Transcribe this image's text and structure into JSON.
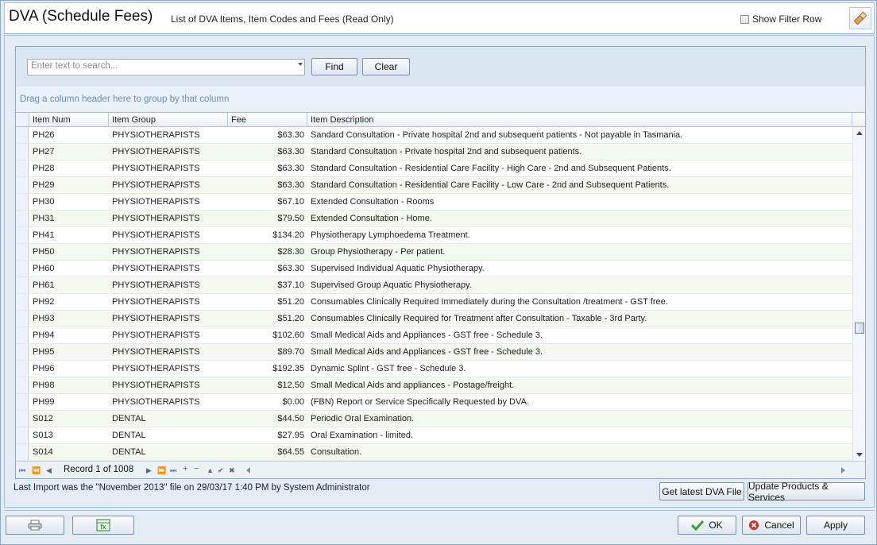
{
  "window": {
    "title": "DVA (Schedule Fees)",
    "subtitle": "List of DVA Items, Item Codes and Fees (Read Only)",
    "show_filter_row_label": "Show Filter Row",
    "show_filter_row_checked": false,
    "icon": "eraser-icon"
  },
  "search": {
    "placeholder": "Enter text to search...",
    "find_label": "Find",
    "clear_label": "Clear"
  },
  "group_panel": {
    "text": "Drag a column header here to group by that column"
  },
  "columns": [
    "Item Num",
    "Item Group",
    "Fee",
    "Item Description"
  ],
  "rows": [
    {
      "item": "PH26",
      "group": "PHYSIOTHERAPISTS",
      "fee": "$63.30",
      "desc": "Sandard Consultation - Private hospital 2nd and subsequent patients - Not payable in Tasmania."
    },
    {
      "item": "PH27",
      "group": "PHYSIOTHERAPISTS",
      "fee": "$63.30",
      "desc": "Standard Consultation - Private hospital 2nd and subsequent patients."
    },
    {
      "item": "PH28",
      "group": "PHYSIOTHERAPISTS",
      "fee": "$63.30",
      "desc": "Standard Consultation - Residential Care Facility - High Care - 2nd and Subsequent Patients."
    },
    {
      "item": "PH29",
      "group": "PHYSIOTHERAPISTS",
      "fee": "$63.30",
      "desc": "Standard Consultation - Residential Care Facility - Low Care - 2nd and Subsequent Patients."
    },
    {
      "item": "PH30",
      "group": "PHYSIOTHERAPISTS",
      "fee": "$67.10",
      "desc": "Extended Consultation - Rooms"
    },
    {
      "item": "PH31",
      "group": "PHYSIOTHERAPISTS",
      "fee": "$79.50",
      "desc": "Extended Consultation - Home."
    },
    {
      "item": "PH41",
      "group": "PHYSIOTHERAPISTS",
      "fee": "$134.20",
      "desc": "Physiotherapy Lymphoedema Treatment."
    },
    {
      "item": "PH50",
      "group": "PHYSIOTHERAPISTS",
      "fee": "$28.30",
      "desc": "Group Physiotherapy - Per patient."
    },
    {
      "item": "PH60",
      "group": "PHYSIOTHERAPISTS",
      "fee": "$63.30",
      "desc": "Supervised Individual Aquatic Physiotherapy."
    },
    {
      "item": "PH61",
      "group": "PHYSIOTHERAPISTS",
      "fee": "$37.10",
      "desc": "Supervised Group Aquatic Physiotherapy."
    },
    {
      "item": "PH92",
      "group": "PHYSIOTHERAPISTS",
      "fee": "$51.20",
      "desc": "Consumables Clinically Required Immediately during the Consultation /treatment - GST free."
    },
    {
      "item": "PH93",
      "group": "PHYSIOTHERAPISTS",
      "fee": "$51.20",
      "desc": "Consumables Clinically Required for Treatment after Consultation - Taxable - 3rd Party."
    },
    {
      "item": "PH94",
      "group": "PHYSIOTHERAPISTS",
      "fee": "$102.60",
      "desc": "Small Medical Aids and Appliances - GST free - Schedule 3."
    },
    {
      "item": "PH95",
      "group": "PHYSIOTHERAPISTS",
      "fee": "$89.70",
      "desc": "Small Medical Aids and Appliances - GST free - Schedule 3."
    },
    {
      "item": "PH96",
      "group": "PHYSIOTHERAPISTS",
      "fee": "$192.35",
      "desc": "Dynamic Splint - GST free - Schedule 3."
    },
    {
      "item": "PH98",
      "group": "PHYSIOTHERAPISTS",
      "fee": "$12.50",
      "desc": "Small Medical Aids and appliances - Postage/freight."
    },
    {
      "item": "PH99",
      "group": "PHYSIOTHERAPISTS",
      "fee": "$0.00",
      "desc": "(FBN) Report or Service Specifically Requested by DVA."
    },
    {
      "item": "S012",
      "group": "DENTAL",
      "fee": "$44.50",
      "desc": "Periodic Oral Examination."
    },
    {
      "item": "S013",
      "group": "DENTAL",
      "fee": "$27.95",
      "desc": "Oral Examination - limited."
    },
    {
      "item": "S014",
      "group": "DENTAL",
      "fee": "$64.55",
      "desc": "Consultation."
    }
  ],
  "navigator": {
    "record_text": "Record 1 of 1008"
  },
  "status": {
    "last_import": "Last Import was the \"November 2013\" file on 29/03/17 1:40 PM by System Administrator",
    "get_latest_label": "Get latest DVA File",
    "update_label": "Update Products & Services"
  },
  "footer": {
    "print_icon": "printer-icon",
    "excel_icon": "excel-export-icon",
    "ok_label": "OK",
    "cancel_label": "Cancel",
    "apply_label": "Apply"
  },
  "colors": {
    "accent": "#6c8fb8",
    "alt_row": "#f3f9ee",
    "ok_check": "#3d9a2d",
    "cancel_x": "#c0392b"
  }
}
